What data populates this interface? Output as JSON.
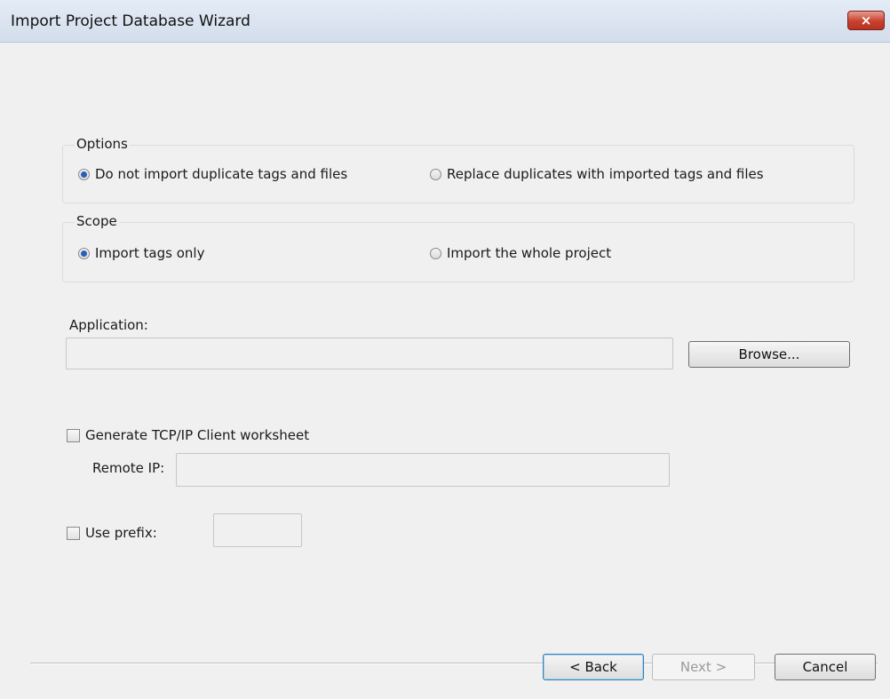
{
  "window": {
    "title": "Import Project Database Wizard",
    "close_symbol": "×"
  },
  "options_group": {
    "label": "Options",
    "radio1": "Do not import duplicate tags and files",
    "radio2": "Replace duplicates with imported tags and files",
    "selected": "radio1"
  },
  "scope_group": {
    "label": "Scope",
    "radio1": "Import tags only",
    "radio2": "Import the whole project",
    "selected": "radio1"
  },
  "application": {
    "label": "Application:",
    "value": "",
    "browse_label": "Browse..."
  },
  "tcpip": {
    "checkbox_label": "Generate TCP/IP Client worksheet",
    "checked": false,
    "remote_ip_label": "Remote IP:",
    "remote_ip_value": ""
  },
  "prefix": {
    "checkbox_label": "Use prefix:",
    "checked": false,
    "value": ""
  },
  "footer": {
    "back_label": "< Back",
    "next_label": "Next >",
    "cancel_label": "Cancel"
  }
}
